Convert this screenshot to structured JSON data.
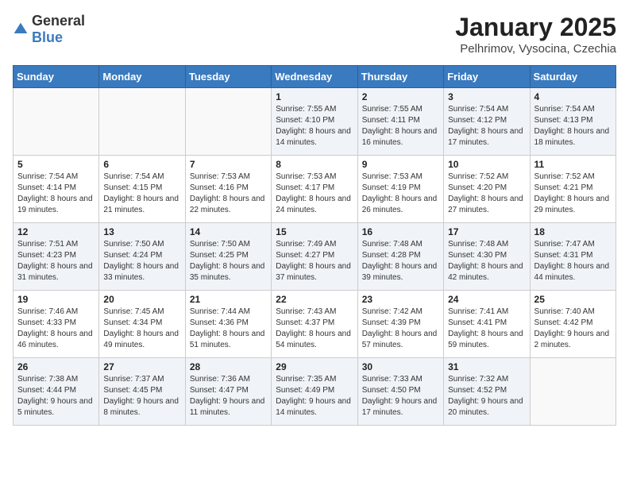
{
  "header": {
    "logo_general": "General",
    "logo_blue": "Blue",
    "title": "January 2025",
    "subtitle": "Pelhrimov, Vysocina, Czechia"
  },
  "weekdays": [
    "Sunday",
    "Monday",
    "Tuesday",
    "Wednesday",
    "Thursday",
    "Friday",
    "Saturday"
  ],
  "weeks": [
    [
      {
        "day": "",
        "info": ""
      },
      {
        "day": "",
        "info": ""
      },
      {
        "day": "",
        "info": ""
      },
      {
        "day": "1",
        "info": "Sunrise: 7:55 AM\nSunset: 4:10 PM\nDaylight: 8 hours and 14 minutes."
      },
      {
        "day": "2",
        "info": "Sunrise: 7:55 AM\nSunset: 4:11 PM\nDaylight: 8 hours and 16 minutes."
      },
      {
        "day": "3",
        "info": "Sunrise: 7:54 AM\nSunset: 4:12 PM\nDaylight: 8 hours and 17 minutes."
      },
      {
        "day": "4",
        "info": "Sunrise: 7:54 AM\nSunset: 4:13 PM\nDaylight: 8 hours and 18 minutes."
      }
    ],
    [
      {
        "day": "5",
        "info": "Sunrise: 7:54 AM\nSunset: 4:14 PM\nDaylight: 8 hours and 19 minutes."
      },
      {
        "day": "6",
        "info": "Sunrise: 7:54 AM\nSunset: 4:15 PM\nDaylight: 8 hours and 21 minutes."
      },
      {
        "day": "7",
        "info": "Sunrise: 7:53 AM\nSunset: 4:16 PM\nDaylight: 8 hours and 22 minutes."
      },
      {
        "day": "8",
        "info": "Sunrise: 7:53 AM\nSunset: 4:17 PM\nDaylight: 8 hours and 24 minutes."
      },
      {
        "day": "9",
        "info": "Sunrise: 7:53 AM\nSunset: 4:19 PM\nDaylight: 8 hours and 26 minutes."
      },
      {
        "day": "10",
        "info": "Sunrise: 7:52 AM\nSunset: 4:20 PM\nDaylight: 8 hours and 27 minutes."
      },
      {
        "day": "11",
        "info": "Sunrise: 7:52 AM\nSunset: 4:21 PM\nDaylight: 8 hours and 29 minutes."
      }
    ],
    [
      {
        "day": "12",
        "info": "Sunrise: 7:51 AM\nSunset: 4:23 PM\nDaylight: 8 hours and 31 minutes."
      },
      {
        "day": "13",
        "info": "Sunrise: 7:50 AM\nSunset: 4:24 PM\nDaylight: 8 hours and 33 minutes."
      },
      {
        "day": "14",
        "info": "Sunrise: 7:50 AM\nSunset: 4:25 PM\nDaylight: 8 hours and 35 minutes."
      },
      {
        "day": "15",
        "info": "Sunrise: 7:49 AM\nSunset: 4:27 PM\nDaylight: 8 hours and 37 minutes."
      },
      {
        "day": "16",
        "info": "Sunrise: 7:48 AM\nSunset: 4:28 PM\nDaylight: 8 hours and 39 minutes."
      },
      {
        "day": "17",
        "info": "Sunrise: 7:48 AM\nSunset: 4:30 PM\nDaylight: 8 hours and 42 minutes."
      },
      {
        "day": "18",
        "info": "Sunrise: 7:47 AM\nSunset: 4:31 PM\nDaylight: 8 hours and 44 minutes."
      }
    ],
    [
      {
        "day": "19",
        "info": "Sunrise: 7:46 AM\nSunset: 4:33 PM\nDaylight: 8 hours and 46 minutes."
      },
      {
        "day": "20",
        "info": "Sunrise: 7:45 AM\nSunset: 4:34 PM\nDaylight: 8 hours and 49 minutes."
      },
      {
        "day": "21",
        "info": "Sunrise: 7:44 AM\nSunset: 4:36 PM\nDaylight: 8 hours and 51 minutes."
      },
      {
        "day": "22",
        "info": "Sunrise: 7:43 AM\nSunset: 4:37 PM\nDaylight: 8 hours and 54 minutes."
      },
      {
        "day": "23",
        "info": "Sunrise: 7:42 AM\nSunset: 4:39 PM\nDaylight: 8 hours and 57 minutes."
      },
      {
        "day": "24",
        "info": "Sunrise: 7:41 AM\nSunset: 4:41 PM\nDaylight: 8 hours and 59 minutes."
      },
      {
        "day": "25",
        "info": "Sunrise: 7:40 AM\nSunset: 4:42 PM\nDaylight: 9 hours and 2 minutes."
      }
    ],
    [
      {
        "day": "26",
        "info": "Sunrise: 7:38 AM\nSunset: 4:44 PM\nDaylight: 9 hours and 5 minutes."
      },
      {
        "day": "27",
        "info": "Sunrise: 7:37 AM\nSunset: 4:45 PM\nDaylight: 9 hours and 8 minutes."
      },
      {
        "day": "28",
        "info": "Sunrise: 7:36 AM\nSunset: 4:47 PM\nDaylight: 9 hours and 11 minutes."
      },
      {
        "day": "29",
        "info": "Sunrise: 7:35 AM\nSunset: 4:49 PM\nDaylight: 9 hours and 14 minutes."
      },
      {
        "day": "30",
        "info": "Sunrise: 7:33 AM\nSunset: 4:50 PM\nDaylight: 9 hours and 17 minutes."
      },
      {
        "day": "31",
        "info": "Sunrise: 7:32 AM\nSunset: 4:52 PM\nDaylight: 9 hours and 20 minutes."
      },
      {
        "day": "",
        "info": ""
      }
    ]
  ]
}
